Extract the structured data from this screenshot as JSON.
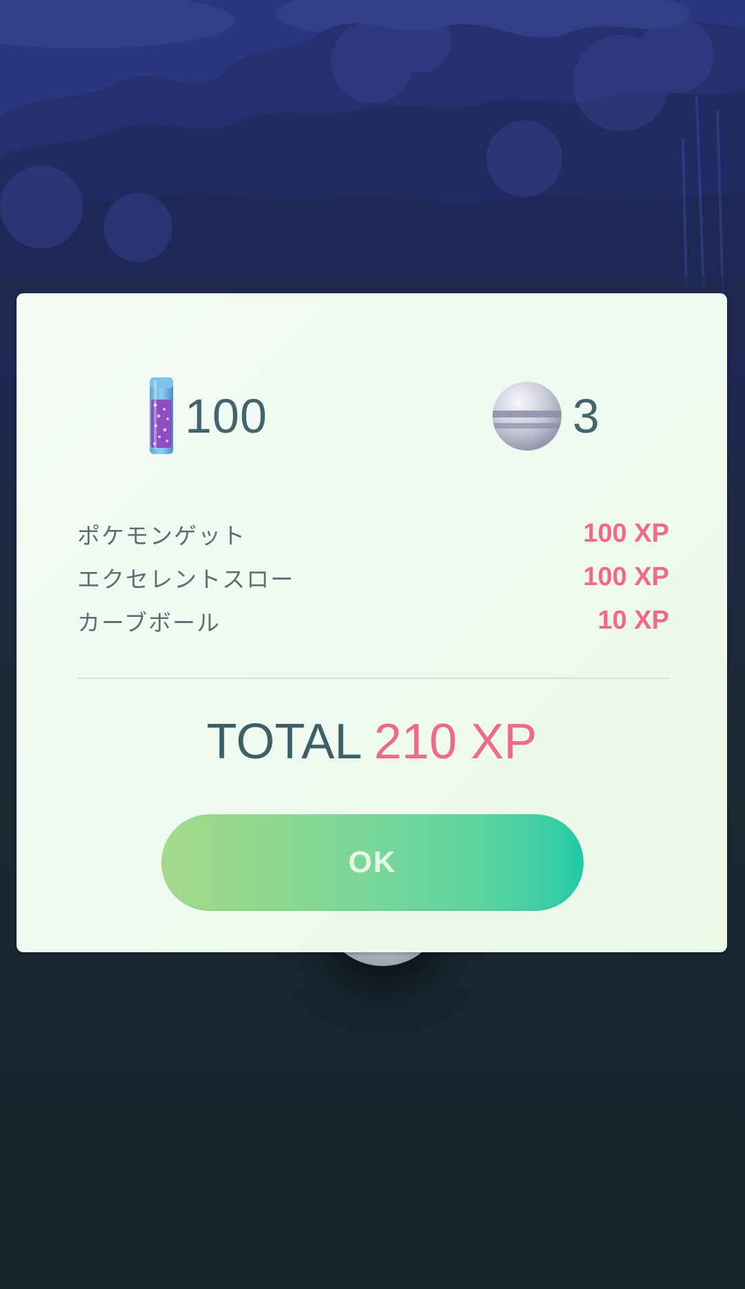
{
  "rewards": {
    "stardust": {
      "icon": "stardust-icon",
      "value": "100"
    },
    "ball": {
      "icon": "curveball-icon",
      "value": "3"
    }
  },
  "xp_breakdown": [
    {
      "label": "ポケモンゲット",
      "value": "100 XP"
    },
    {
      "label": "エクセレントスロー",
      "value": "100 XP"
    },
    {
      "label": "カーブボール",
      "value": "10 XP"
    }
  ],
  "total": {
    "label": "TOTAL",
    "value": "210 XP"
  },
  "ok_button": {
    "label": "OK"
  },
  "colors": {
    "xp_pink": "#f06a87",
    "text_teal": "#44636a",
    "button_start": "#a6d98c",
    "button_end": "#1fcaa8",
    "dialog_bg": "#f1faf1"
  }
}
